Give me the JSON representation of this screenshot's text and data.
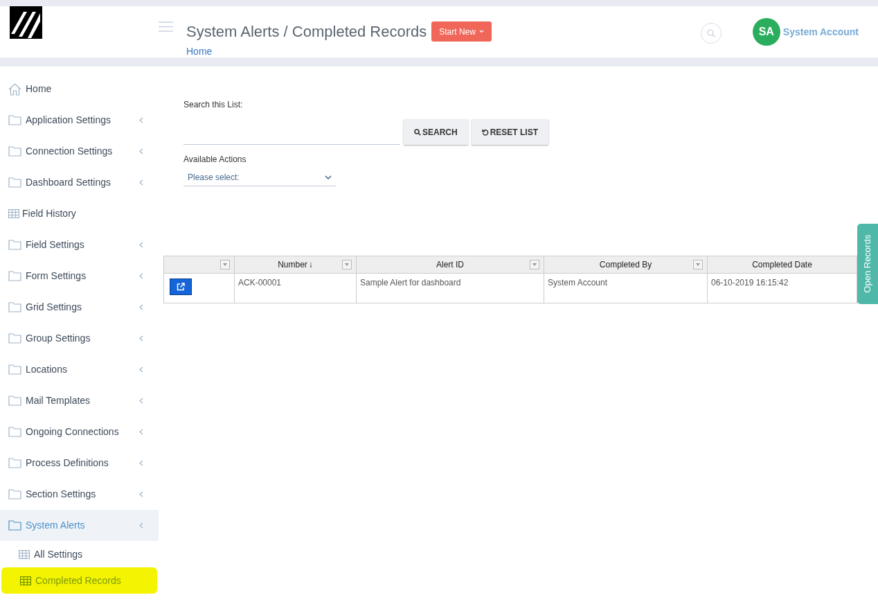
{
  "header": {
    "title": "System Alerts / Completed Records",
    "start_button": "Start New",
    "breadcrumb": "Home",
    "avatar_initials": "SA",
    "user_name": "System Account"
  },
  "sidebar": {
    "items": [
      {
        "kind": "home",
        "label": "Home"
      },
      {
        "kind": "folder",
        "label": "Application Settings",
        "expanded": false
      },
      {
        "kind": "folder",
        "label": "Connection Settings",
        "expanded": false
      },
      {
        "kind": "folder",
        "label": "Dashboard Settings",
        "expanded": false
      },
      {
        "kind": "table",
        "label": "Field History"
      },
      {
        "kind": "folder",
        "label": "Field Settings",
        "expanded": false
      },
      {
        "kind": "folder",
        "label": "Form Settings",
        "expanded": false
      },
      {
        "kind": "folder",
        "label": "Grid Settings",
        "expanded": false
      },
      {
        "kind": "folder",
        "label": "Group Settings",
        "expanded": false
      },
      {
        "kind": "folder",
        "label": "Locations",
        "expanded": false
      },
      {
        "kind": "folder",
        "label": "Mail Templates",
        "expanded": false
      },
      {
        "kind": "folder",
        "label": "Ongoing Connections",
        "expanded": false
      },
      {
        "kind": "folder",
        "label": "Process Definitions",
        "expanded": false
      },
      {
        "kind": "folder",
        "label": "Section Settings",
        "expanded": false
      },
      {
        "kind": "folder",
        "label": "System Alerts",
        "expanded": true,
        "children": [
          {
            "label": "All Settings",
            "selected": false
          },
          {
            "label": "Completed Records",
            "selected": true
          }
        ]
      }
    ]
  },
  "search": {
    "label": "Search this List:",
    "search_button": "SEARCH",
    "reset_button": "RESET LIST"
  },
  "actions": {
    "label": "Available Actions",
    "placeholder": "Please select:"
  },
  "table": {
    "columns": [
      {},
      {
        "label": "Number",
        "sort": "↓"
      },
      {
        "label": "Alert ID"
      },
      {
        "label": "Completed By"
      },
      {
        "label": "Completed Date"
      }
    ],
    "rows": [
      {
        "cells": [
          "",
          "ACK-00001",
          "Sample Alert for dashboard",
          "System Account",
          "06-10-2019 16:15:42"
        ]
      }
    ]
  },
  "side_tab": "Open Records"
}
